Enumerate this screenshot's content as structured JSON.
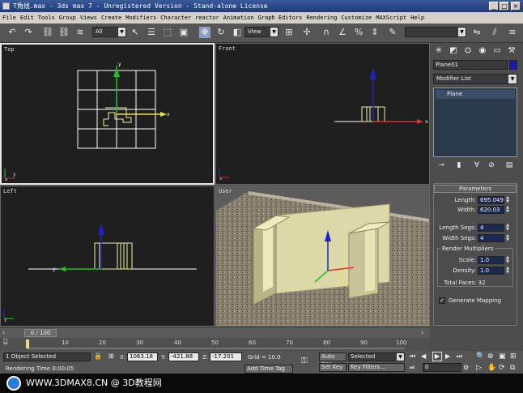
{
  "window": {
    "title": "T角线.max - 3ds max 7 - Unregistered Version - Stand-alone License"
  },
  "menu": [
    "File",
    "Edit",
    "Tools",
    "Group",
    "Views",
    "Create",
    "Modifiers",
    "Character",
    "reactor",
    "Animation",
    "Graph Editors",
    "Rendering",
    "Customize",
    "MAXScript",
    "Help"
  ],
  "toolbar": {
    "selection_filter": "All",
    "ref_coord": "View",
    "named_sel": ""
  },
  "viewports": {
    "top": "Top",
    "front": "Front",
    "left": "Left",
    "user": "User"
  },
  "panel": {
    "object_name": "Plane01",
    "modifier_list": "Modifier List",
    "stack_item": "Plane",
    "params_title": "Parameters",
    "length_label": "Length:",
    "length": "695.049",
    "width_label": "Width:",
    "width": "620.03",
    "length_segs_label": "Length Segs:",
    "length_segs": "4",
    "width_segs_label": "Width Segs:",
    "width_segs": "4",
    "render_mult_title": "Render Multipliers",
    "scale_label": "Scale:",
    "scale": "1.0",
    "density_label": "Density:",
    "density": "1.0",
    "total_faces": "Total Faces: 32",
    "gen_mapping": "Generate Mapping"
  },
  "timeline": {
    "frame": "0 / 100",
    "ticks": [
      "10",
      "20",
      "30",
      "40",
      "50",
      "60",
      "70",
      "80",
      "90",
      "100"
    ]
  },
  "status": {
    "selection": "1 Object Selected",
    "x_label": "X:",
    "x": "1063.18",
    "y_label": "Y:",
    "y": "-421.88",
    "z_label": "Z:",
    "z": "-17.201",
    "grid": "Grid = 10.0",
    "auto_key": "Auto Key",
    "set_key": "Set Key",
    "key_mode": "Selected",
    "key_filters": "Key Filters...",
    "frame_field": "0",
    "prompt": "Rendering Time  0:00:05",
    "add_time_tag": "Add Time Tag"
  },
  "watermark": "WWW.3DMAX8.CN @ 3D教程网"
}
